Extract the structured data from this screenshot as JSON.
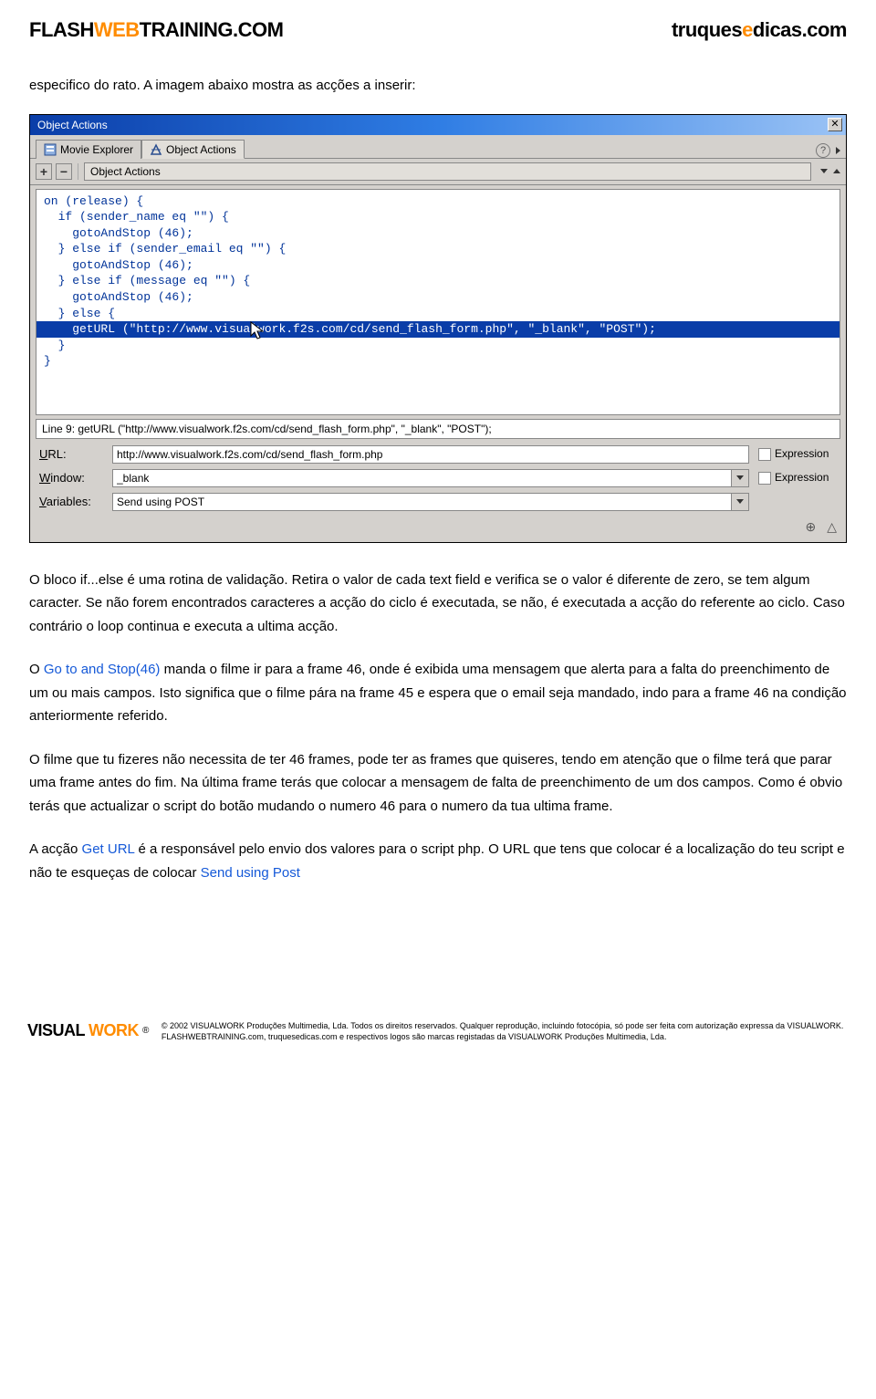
{
  "header": {
    "left": {
      "p1": "FLASH",
      "p2": "WEB",
      "p3": "TRAINING.COM"
    },
    "right": {
      "p1": "truques",
      "p2": "e",
      "p3": "dicas.com"
    }
  },
  "intro": "especifico do rato. A imagem abaixo mostra as acções a inserir:",
  "window": {
    "title": "Object Actions",
    "tabs": [
      "Movie Explorer",
      "Object Actions"
    ],
    "dropdown": "Object Actions",
    "code": {
      "l1": "on (release) {",
      "l2": "  if (sender_name eq \"\") {",
      "l3": "    gotoAndStop (46);",
      "l4": "  } else if (sender_email eq \"\") {",
      "l5": "    gotoAndStop (46);",
      "l6": "  } else if (message eq \"\") {",
      "l7": "    gotoAndStop (46);",
      "l8": "  } else {",
      "l9": "    getURL (\"http://www.visualwork.f2s.com/cd/send_flash_form.php\", \"_blank\", \"POST\");",
      "l10": "  }",
      "l11": "}"
    },
    "statusline": "Line 9: getURL (\"http://www.visualwork.f2s.com/cd/send_flash_form.php\", \"_blank\", \"POST\");",
    "form": {
      "url_label_pre": "",
      "url_label_u": "U",
      "url_label_post": "RL:",
      "url_value": "http://www.visualwork.f2s.com/cd/send_flash_form.php",
      "win_label_pre": "",
      "win_label_u": "W",
      "win_label_post": "indow:",
      "win_value": "_blank",
      "vars_label_pre": "",
      "vars_label_u": "V",
      "vars_label_post": "ariables:",
      "vars_value": "Send using POST",
      "expression": "Expression"
    }
  },
  "body": {
    "p1": "O bloco if...else é uma rotina de validação. Retira o valor de cada text field e verifica se o valor é diferente de zero, se tem algum caracter. Se não forem encontrados caracteres a acção do ciclo é executada, se não, é executada a acção do referente ao ciclo. Caso contrário o loop continua e executa a ultima acção.",
    "p2a": "O ",
    "p2b": "Go to and Stop(46)",
    "p2c": " manda o filme ir para a frame 46, onde é exibida uma mensagem que alerta para a falta do preenchimento de um ou mais campos. Isto significa que o filme pára na frame 45 e espera que o email seja mandado, indo para a frame 46 na condição anteriormente referido.",
    "p3": "O filme que tu fizeres não necessita de ter 46 frames, pode ter as frames que quiseres, tendo em atenção que o filme terá que parar uma frame antes do fim. Na última frame terás que colocar a mensagem de falta de preenchimento de um dos campos. Como é obvio terás que actualizar o script do botão mudando o numero 46 para o numero da tua ultima frame.",
    "p4a": "A acção ",
    "p4b": "Get URL",
    "p4c": " é a responsável pelo envio dos valores para o script php. O URL que tens que colocar é a localização do teu script e não te esqueças de colocar ",
    "p4d": "Send using Post"
  },
  "footer": {
    "brand": {
      "p1": "VISUAL",
      "p2": "WORK",
      "reg": "®"
    },
    "line1": "© 2002 VISUALWORK Produções Multimedia, Lda. Todos os direitos reservados. Qualquer reprodução, incluindo fotocópia, só pode ser feita com autorização expressa da VISUALWORK.",
    "line2": "FLASHWEBTRAINING.com, truquesedicas.com e respectivos logos são marcas registadas da VISUALWORK Produções Multimedia, Lda."
  }
}
